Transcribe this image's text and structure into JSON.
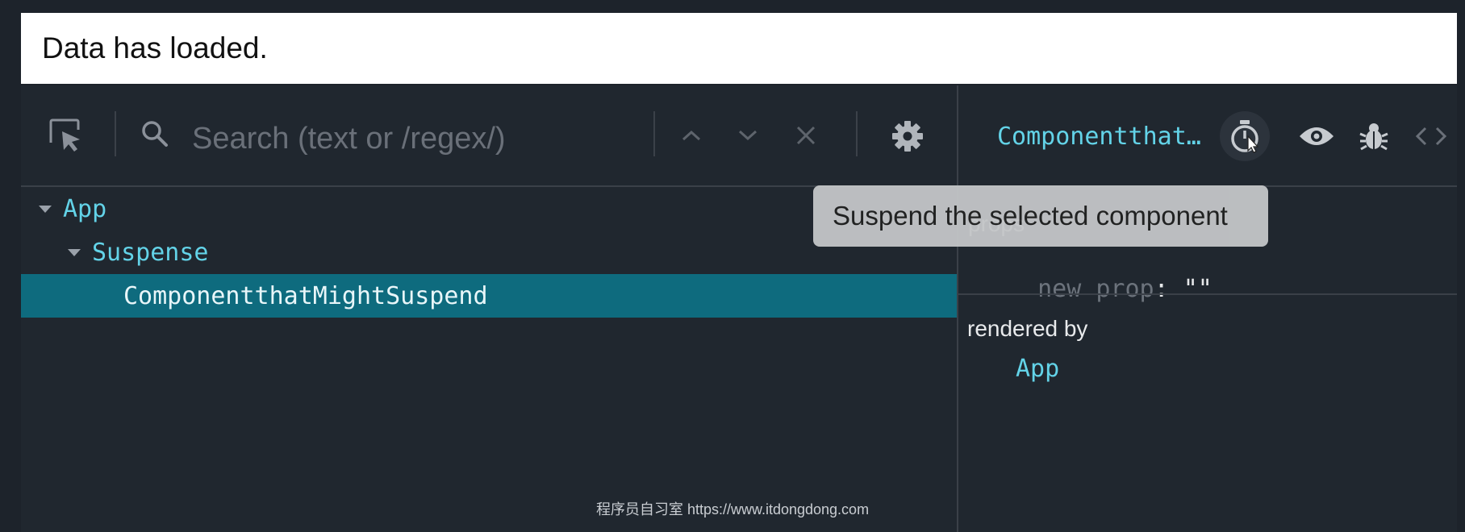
{
  "banner": {
    "text": "Data has loaded."
  },
  "toolbar": {
    "select_tool_icon": "select-element-icon",
    "search_icon": "search-icon",
    "search_placeholder": "Search (text or /regex/)",
    "prev_icon": "chevron-up-icon",
    "next_icon": "chevron-down-icon",
    "clear_icon": "close-icon",
    "settings_icon": "gear-icon"
  },
  "tree": {
    "items": [
      {
        "label": "App",
        "expanded": true,
        "selected": false
      },
      {
        "label": "Suspense",
        "expanded": true,
        "selected": false
      },
      {
        "label": "ComponentthatMightSuspend",
        "expanded": false,
        "selected": true
      }
    ]
  },
  "inspector": {
    "title": "Componentthat…",
    "icons": [
      "stopwatch-icon",
      "eye-icon",
      "bug-icon",
      "code-icon"
    ],
    "tooltip": "Suspend the selected component",
    "props_label": "props",
    "props": [
      {
        "name": "new prop",
        "value": "\"\""
      }
    ],
    "rendered_by_label": "rendered by",
    "rendered_by": [
      "App"
    ]
  },
  "watermark": "程序员自习室 https://www.itdongdong.com",
  "colors": {
    "background": "#20272f",
    "accent": "#63d3e8",
    "selected_row": "#0e6b7e",
    "tooltip": "#c4c6c8"
  }
}
